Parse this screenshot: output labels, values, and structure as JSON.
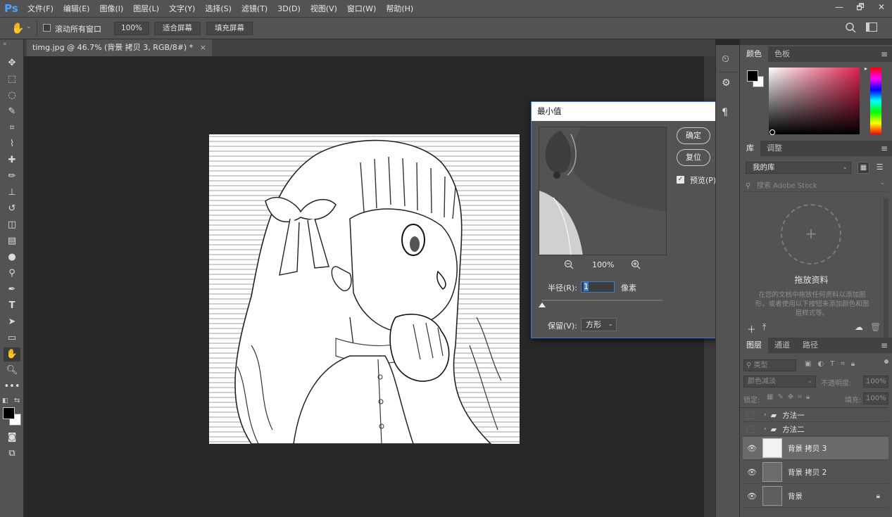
{
  "app": {
    "logo": "Ps"
  },
  "menu": [
    "文件(F)",
    "编辑(E)",
    "图像(I)",
    "图层(L)",
    "文字(Y)",
    "选择(S)",
    "滤镜(T)",
    "3D(D)",
    "视图(V)",
    "窗口(W)",
    "帮助(H)"
  ],
  "window_controls": {
    "minimize": "—",
    "restore": "🗗",
    "close": "✕"
  },
  "options": {
    "scroll_all_label": "滚动所有窗口",
    "zoom_value": "100%",
    "fit_screen": "适合屏幕",
    "fill_screen": "填充屏幕"
  },
  "document": {
    "tab_title": "timg.jpg @ 46.7% (背景 拷贝 3, RGB/8#) *",
    "tab_close": "×"
  },
  "dialog": {
    "title": "最小值",
    "ok": "确定",
    "reset": "复位",
    "preview_label": "预览(P)",
    "preview_checked": true,
    "zoom": "100%",
    "radius_label": "半径(R):",
    "radius_value": "1",
    "radius_unit": "像素",
    "radius_slider_fraction": 0.0,
    "preserve_label": "保留(V):",
    "preserve_value": "方形"
  },
  "color_panel": {
    "tabs": [
      "颜色",
      "色板"
    ],
    "foreground": "#000000",
    "background": "#ffffff"
  },
  "library_panel": {
    "tabs": [
      "库",
      "调整"
    ],
    "library_select": "我的库",
    "search_placeholder": "搜索 Adobe Stock",
    "drop_title": "拖放资料",
    "drop_desc": "在您的文档中拖放任何资料以添加图形，或者使用以下按钮来添加颜色和图层样式等。"
  },
  "layers_panel": {
    "tabs": [
      "图层",
      "通道",
      "路径"
    ],
    "filter_label": "类型",
    "blend_mode": "颜色减淡",
    "opacity_label": "不透明度:",
    "opacity_value": "100%",
    "lock_label": "锁定:",
    "fill_label": "填充:",
    "fill_value": "100%",
    "groups": [
      {
        "name": "方法一"
      },
      {
        "name": "方法二"
      }
    ],
    "layers": [
      {
        "name": "背景 拷贝 3",
        "selected": true,
        "locked": false
      },
      {
        "name": "背景 拷贝 2",
        "selected": false,
        "locked": false
      },
      {
        "name": "背景",
        "selected": false,
        "locked": true
      }
    ]
  }
}
